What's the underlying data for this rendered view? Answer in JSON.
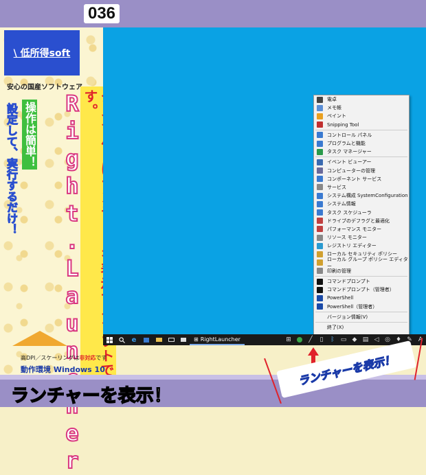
{
  "header": {
    "number": "036"
  },
  "logo": {
    "text": "\\ 低所得soft"
  },
  "tagline": "安心の国産ソフトウェア",
  "taglines": {
    "main": "タスクバーにランチャーを表示するソフトです。",
    "title": "Right.Launcher",
    "easy": "操作は簡単！",
    "setup": "設定して、実行するだけ！"
  },
  "dpi_note": {
    "prefix": "高DPI／スケーリングは",
    "highlight": "非対応",
    "suffix": "です"
  },
  "env": "動作環境 Windows 10",
  "taskbar": {
    "app_label": "RightLauncher"
  },
  "menu": {
    "groups": [
      [
        {
          "label": "電卓",
          "color": "#444"
        },
        {
          "label": "メモ帳",
          "color": "#5b8fd6"
        },
        {
          "label": "ペイント",
          "color": "#e8a020"
        },
        {
          "label": "Snipping Tool",
          "color": "#c03030"
        }
      ],
      [
        {
          "label": "コントロール パネル",
          "color": "#3a7ad0"
        },
        {
          "label": "プログラムと機能",
          "color": "#3a7ad0"
        },
        {
          "label": "タスク マネージャー",
          "color": "#2a9a4a"
        }
      ],
      [
        {
          "label": "イベント ビューアー",
          "color": "#3a6ab0"
        },
        {
          "label": "コンピューターの管理",
          "color": "#6a6a9a"
        },
        {
          "label": "コンポーネント サービス",
          "color": "#3a7ad0"
        },
        {
          "label": "サービス",
          "color": "#888"
        },
        {
          "label": "システム構成 SystemConfiguration",
          "color": "#3a7ad0"
        },
        {
          "label": "システム情報",
          "color": "#3a7ad0"
        },
        {
          "label": "タスク スケジューラ",
          "color": "#3a7ad0"
        },
        {
          "label": "ドライブのデフラグと最適化",
          "color": "#c04040"
        },
        {
          "label": "パフォーマンス モニター",
          "color": "#c04040"
        },
        {
          "label": "リソース モニター",
          "color": "#888"
        },
        {
          "label": "レジストリ エディター",
          "color": "#2a9ad0"
        },
        {
          "label": "ローカル セキュリティ ポリシー",
          "color": "#d0a030"
        },
        {
          "label": "ローカル グループ ポリシー エディター",
          "color": "#d0a030"
        },
        {
          "label": "印刷の管理",
          "color": "#888"
        }
      ],
      [
        {
          "label": "コマンドプロンプト",
          "color": "#111"
        },
        {
          "label": "コマンドプロンプト（管理者）",
          "color": "#111"
        },
        {
          "label": "PowerShell",
          "color": "#1a4aa8"
        },
        {
          "label": "PowerShell（管理者）",
          "color": "#1a4aa8"
        }
      ],
      [
        {
          "label": "バージョン情報(V)",
          "color": ""
        }
      ],
      [
        {
          "label": "終了(X)",
          "color": ""
        }
      ]
    ]
  },
  "callout": "ランチャーを表示！",
  "caption": "ランチャーを表示！",
  "colors": {
    "accent_red": "#e0222b",
    "desktop": "#0aa2e4",
    "stripe": "#9a8fc6"
  }
}
